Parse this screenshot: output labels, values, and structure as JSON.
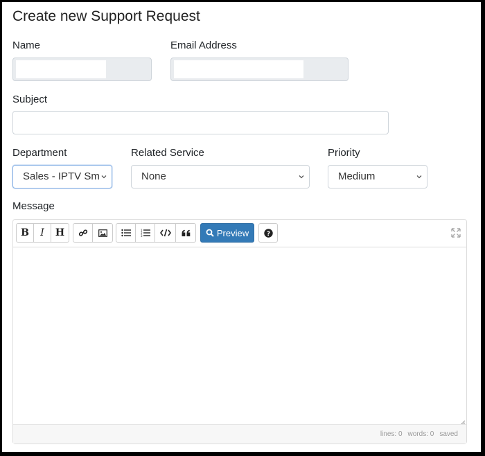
{
  "page": {
    "title": "Create new Support Request"
  },
  "form": {
    "name": {
      "label": "Name",
      "value": ""
    },
    "email": {
      "label": "Email Address",
      "value": ""
    },
    "subject": {
      "label": "Subject",
      "value": ""
    },
    "department": {
      "label": "Department",
      "selected": "Sales - IPTV Sm"
    },
    "related_service": {
      "label": "Related Service",
      "selected": "None"
    },
    "priority": {
      "label": "Priority",
      "selected": "Medium"
    },
    "message": {
      "label": "Message",
      "value": ""
    }
  },
  "editor": {
    "toolbar": {
      "bold_icon": "bold-icon",
      "italic_icon": "italic-icon",
      "heading_icon": "heading-icon",
      "link_icon": "link-icon",
      "image_icon": "image-icon",
      "unordered_list_icon": "unordered-list-icon",
      "ordered_list_icon": "ordered-list-icon",
      "code_icon": "code-icon",
      "quote_icon": "quote-icon",
      "preview_label": "Preview",
      "help_icon": "help-icon",
      "fullscreen_icon": "fullscreen-icon"
    },
    "status": {
      "lines": "lines: 0",
      "words": "words: 0",
      "saved": "saved"
    }
  },
  "colors": {
    "primary": "#337ab7",
    "readonly_bg": "#e9ecef",
    "border": "#ced4da"
  }
}
